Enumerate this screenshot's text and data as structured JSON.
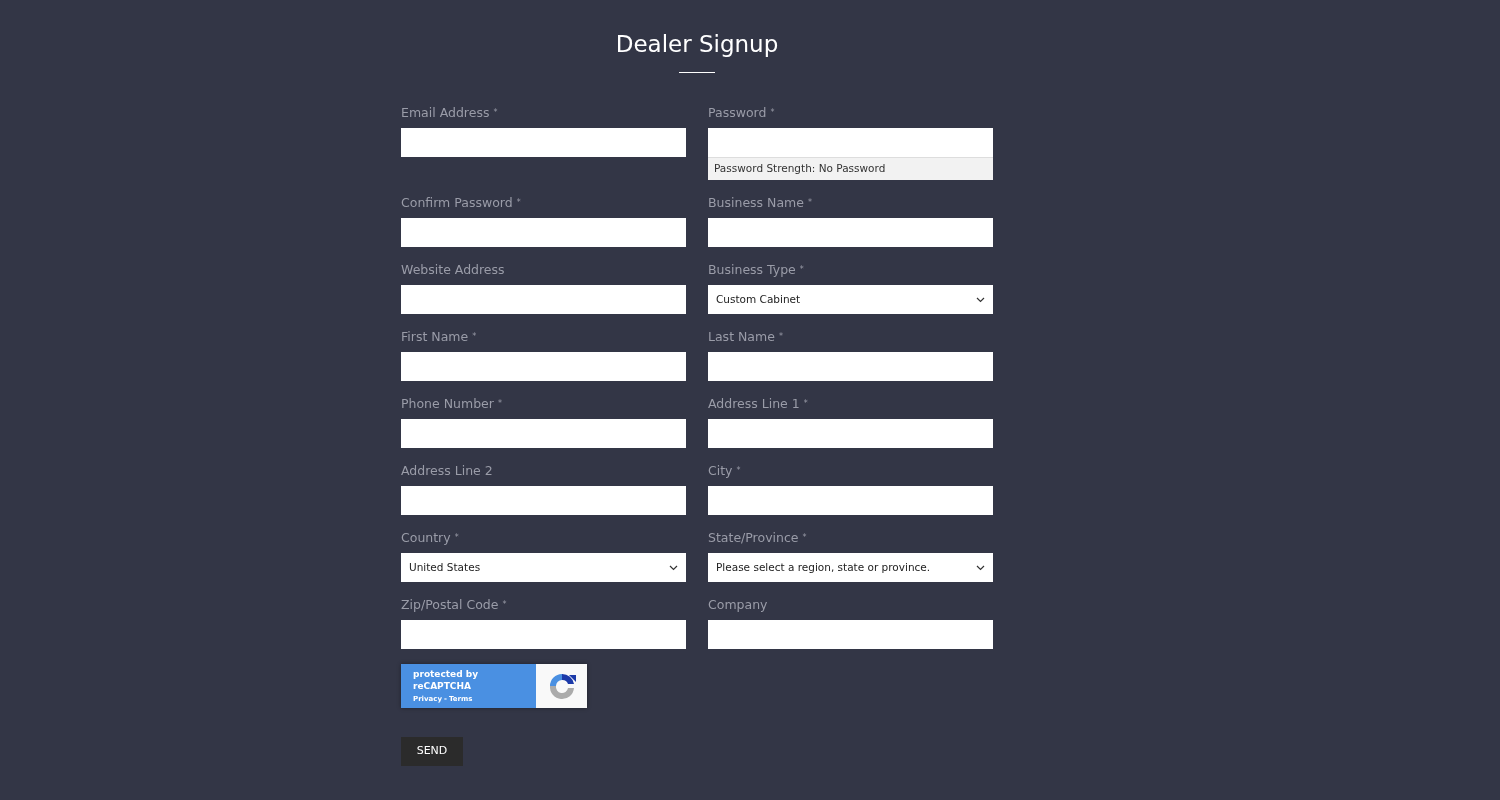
{
  "title": "Dealer Signup",
  "fields": [
    {
      "label": "Email Address",
      "mark": "*",
      "kind": "text"
    },
    {
      "label": "Password",
      "mark": "*",
      "kind": "password",
      "strength": "Password Strength: No Password"
    },
    {
      "label": "Confirm Password",
      "mark": "*",
      "kind": "text"
    },
    {
      "label": "Business Name",
      "mark": "*",
      "kind": "text"
    },
    {
      "label": "Website Address",
      "kind": "text"
    },
    {
      "label": "Business Type",
      "mark": "*",
      "kind": "select",
      "value": "Custom Cabinet"
    },
    {
      "label": "First Name",
      "mark": "*",
      "kind": "text"
    },
    {
      "label": "Last Name",
      "mark": "*",
      "kind": "text"
    },
    {
      "label": "Phone Number",
      "mark": "*",
      "kind": "text"
    },
    {
      "label": "Address Line 1",
      "mark": "*",
      "kind": "text"
    },
    {
      "label": "Address Line 2",
      "kind": "text"
    },
    {
      "label": "City",
      "mark": "*",
      "kind": "text"
    },
    {
      "label": "Country",
      "mark": "*",
      "kind": "select",
      "value": "United States"
    },
    {
      "label": "State/Province",
      "mark": "*",
      "kind": "select",
      "value": "Please select a region, state or province."
    },
    {
      "label": "Zip/Postal Code",
      "mark": "*",
      "kind": "text"
    },
    {
      "label": "Company",
      "kind": "text"
    }
  ],
  "recaptcha": {
    "text": "protected by reCAPTCHA",
    "privacy": "Privacy",
    "separator": "-",
    "terms": "Terms"
  },
  "send_button": "SEND"
}
